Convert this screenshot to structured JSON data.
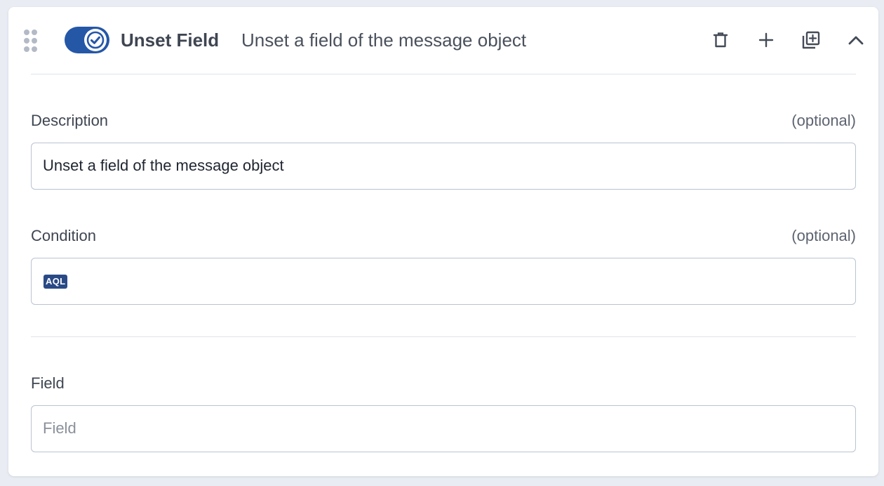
{
  "header": {
    "title": "Unset Field",
    "subtitle": "Unset a field of the message object",
    "enabled": true
  },
  "description": {
    "label": "Description",
    "optional": "(optional)",
    "value": "Unset a field of the message object"
  },
  "condition": {
    "label": "Condition",
    "optional": "(optional)",
    "badge": "AQL",
    "value": ""
  },
  "field": {
    "label": "Field",
    "placeholder": "Field",
    "value": ""
  },
  "colors": {
    "toggle_on": "#2557a7",
    "aql_badge": "#2a4a86"
  },
  "icons": [
    "drag-handle-icon",
    "check-icon",
    "delete-icon",
    "add-icon",
    "duplicate-icon",
    "collapse-icon"
  ]
}
